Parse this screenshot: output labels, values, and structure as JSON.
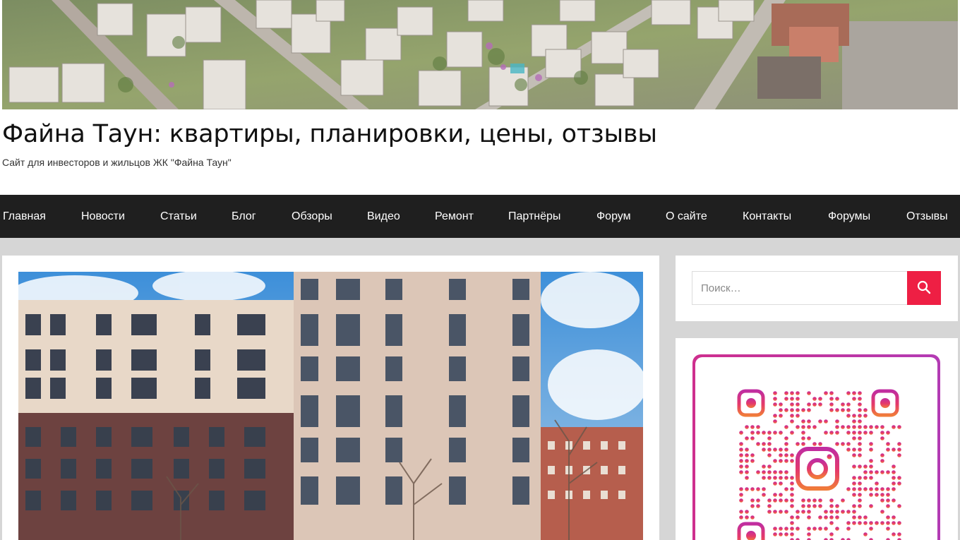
{
  "site": {
    "title": "Файна Таун: квартиры, планировки, цены, отзывы",
    "description": "Сайт для инвесторов и жильцов ЖК \"Файна Таун\""
  },
  "nav": {
    "items": [
      {
        "label": "Главная"
      },
      {
        "label": "Новости"
      },
      {
        "label": "Статьи"
      },
      {
        "label": "Блог"
      },
      {
        "label": "Обзоры"
      },
      {
        "label": "Видео"
      },
      {
        "label": "Ремонт"
      },
      {
        "label": "Партнёры"
      },
      {
        "label": "Форум"
      },
      {
        "label": "О сайте"
      },
      {
        "label": "Контакты"
      },
      {
        "label": "Форумы"
      },
      {
        "label": "Отзывы"
      }
    ]
  },
  "search": {
    "placeholder": "Поиск…",
    "button_icon": "search-icon"
  },
  "qr_widget": {
    "icon": "instagram-icon"
  },
  "colors": {
    "nav_bg": "#1f1f1f",
    "accent": "#ee1f44",
    "qr_gradient_start": "#ce2f8e",
    "qr_gradient_end": "#b33bb4"
  }
}
